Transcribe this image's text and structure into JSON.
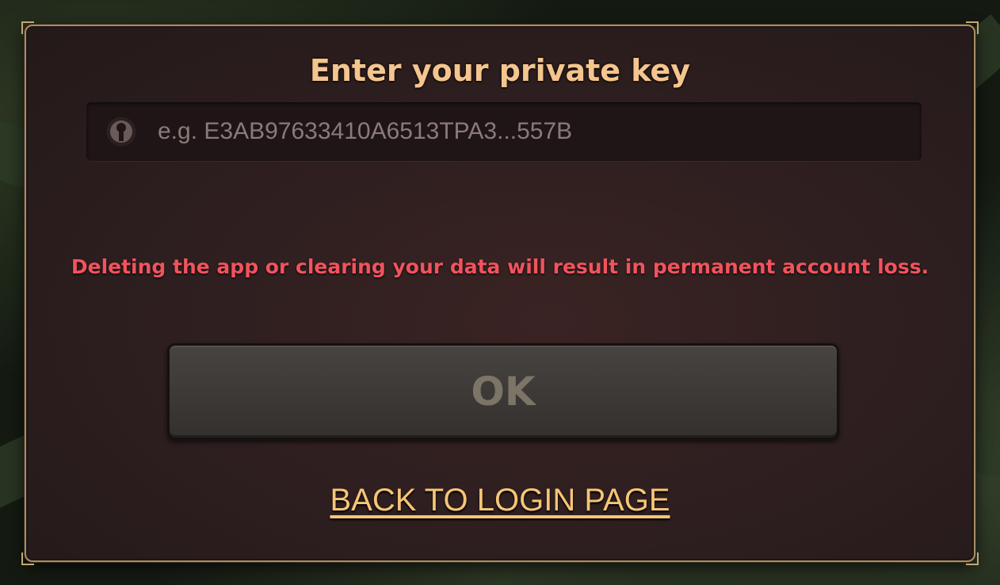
{
  "dialog": {
    "title": "Enter your private key",
    "key_field": {
      "value": "",
      "placeholder": "e.g. E3AB97633410A6513TPA3...557B",
      "icon": "keyhole-icon"
    },
    "warning": "Deleting the app or clearing your data will result in permanent account loss.",
    "ok_label": "OK",
    "back_link": "BACK TO LOGIN PAGE"
  },
  "colors": {
    "title": "#f4c58e",
    "warning": "#f1535d",
    "link": "#f6c576",
    "button_disabled_text": "#7c7466"
  }
}
